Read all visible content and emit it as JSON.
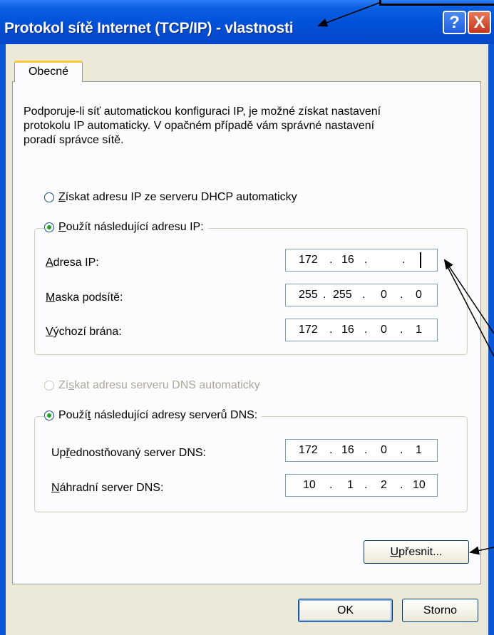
{
  "window": {
    "title": "Protokol sítě Internet (TCP/IP) - vlastnosti",
    "help_label": "?",
    "close_label": "X"
  },
  "tabs": [
    {
      "label": "Obecné",
      "active": true
    }
  ],
  "description": [
    "Podporuje-li síť automatickou konfiguraci IP, je možné získat nastavení",
    "protokolu IP automaticky. V opačném případě vám správné nastavení",
    "poradí správce sítě."
  ],
  "ip": {
    "auto_option": {
      "pre": "",
      "key": "Z",
      "post": "ískat adresu IP ze serveru DHCP automaticky",
      "selected": false
    },
    "manual_option": {
      "pre": "",
      "key": "P",
      "post": "oužít následující adresu IP:",
      "selected": true
    },
    "fields": [
      {
        "pre": "",
        "key": "A",
        "post": "dresa IP:",
        "octets": [
          "172",
          "16",
          "",
          ""
        ],
        "cursor": true
      },
      {
        "pre": "",
        "key": "M",
        "post": "aska podsítě:",
        "octets": [
          "255",
          "255",
          "0",
          "0"
        ]
      },
      {
        "pre": "",
        "key": "V",
        "post": "ýchozí brána:",
        "octets": [
          "172",
          "16",
          "0",
          "1"
        ]
      }
    ]
  },
  "dns": {
    "auto_option": {
      "pre": "Zí",
      "key": "s",
      "post": "kat adresu serveru DNS automaticky",
      "selected": false,
      "disabled": true
    },
    "manual_option": {
      "pre": "Použí",
      "key": "t",
      "post": " následující adresy serverů DNS:",
      "selected": true
    },
    "fields": [
      {
        "pre": "Up",
        "key": "ř",
        "post": "ednostňovaný server DNS:",
        "octets": [
          "172",
          "16",
          "0",
          "1"
        ]
      },
      {
        "pre": "",
        "key": "N",
        "post": "áhradní server DNS:",
        "octets": [
          "10",
          "1",
          "2",
          "10"
        ]
      }
    ]
  },
  "buttons": {
    "advanced": {
      "pre": "",
      "key": "U",
      "post": "přesnit..."
    },
    "ok": "OK",
    "cancel": "Storno"
  },
  "colors": {
    "title_bar": "#0050d8",
    "client_bg": "#ece9d8",
    "panel_bg": "#fcfcfe",
    "radio_dot": "#21a121",
    "tab_highlight": "#ffc83c"
  }
}
